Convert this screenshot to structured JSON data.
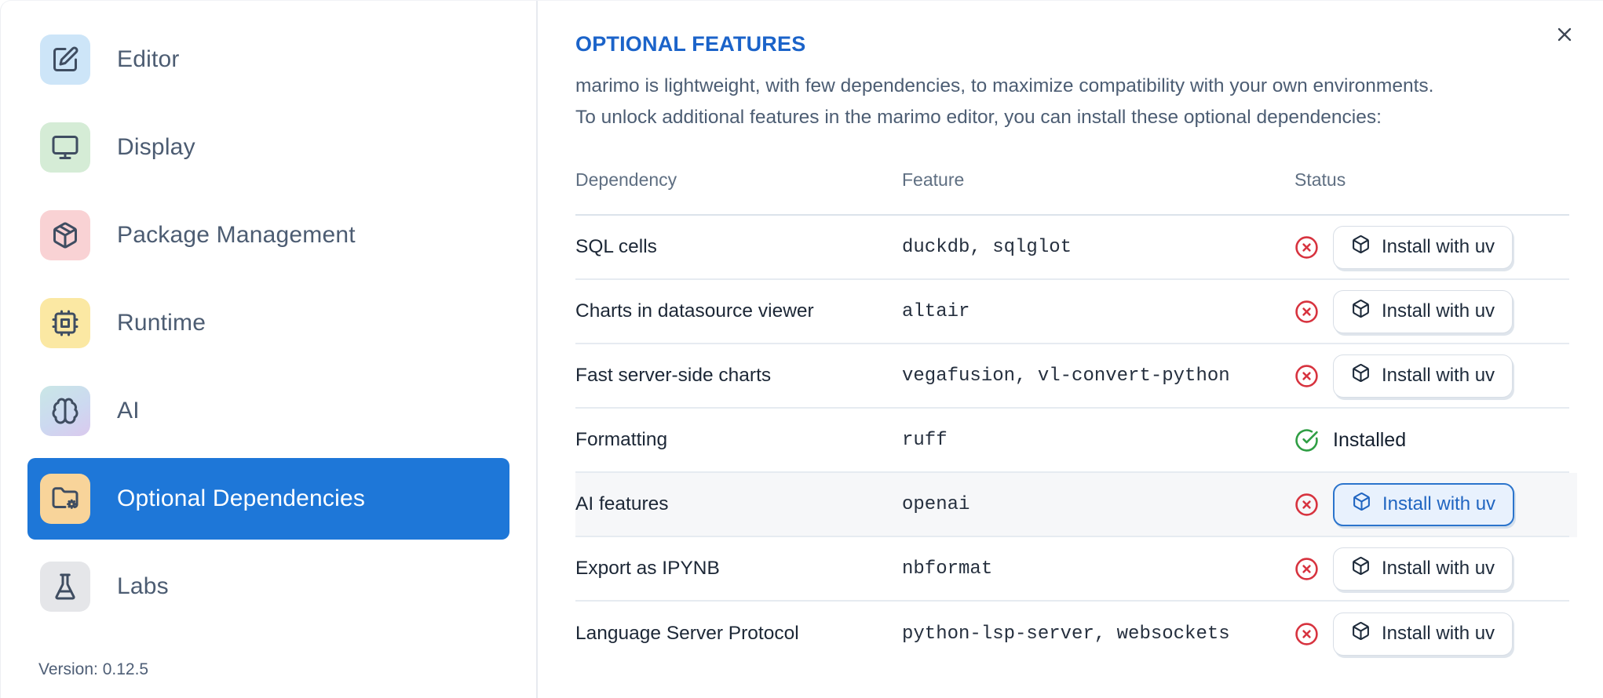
{
  "sidebar": {
    "items": [
      {
        "label": "Editor",
        "icon": "edit-icon",
        "tile_bg": "#cde5f8"
      },
      {
        "label": "Display",
        "icon": "monitor-icon",
        "tile_bg": "#d5ecd6"
      },
      {
        "label": "Package Management",
        "icon": "package-icon",
        "tile_bg": "#f9d2d4"
      },
      {
        "label": "Runtime",
        "icon": "cpu-icon",
        "tile_bg": "#fbe8a3"
      },
      {
        "label": "AI",
        "icon": "brain-icon",
        "tile_bg": "linear-gradient(150deg,#c9e7e6 0%,#ccd9f0 55%,#dac9ee 100%)"
      },
      {
        "label": "Optional Dependencies",
        "icon": "folder-cog-icon",
        "tile_bg": "#f8d49a",
        "selected": true
      },
      {
        "label": "Labs",
        "icon": "flask-icon",
        "tile_bg": "#e5e6e9"
      }
    ],
    "version_label": "Version: 0.12.5"
  },
  "panel": {
    "title": "OPTIONAL FEATURES",
    "description_lines": [
      "marimo is lightweight, with few dependencies, to maximize compatibility with your own environments.",
      "To unlock additional features in the marimo editor, you can install these optional dependencies:"
    ]
  },
  "table": {
    "headers": [
      "Dependency",
      "Feature",
      "Status"
    ],
    "install_button_label": "Install with uv",
    "installed_label": "Installed",
    "rows": [
      {
        "dependency": "SQL cells",
        "feature": "duckdb, sqlglot",
        "installed": false,
        "highlight": false
      },
      {
        "dependency": "Charts in datasource viewer",
        "feature": "altair",
        "installed": false,
        "highlight": false
      },
      {
        "dependency": "Fast server-side charts",
        "feature": "vegafusion, vl-convert-python",
        "installed": false,
        "highlight": false
      },
      {
        "dependency": "Formatting",
        "feature": "ruff",
        "installed": true,
        "highlight": false
      },
      {
        "dependency": "AI features",
        "feature": "openai",
        "installed": false,
        "highlight": true
      },
      {
        "dependency": "Export as IPYNB",
        "feature": "nbformat",
        "installed": false,
        "highlight": false
      },
      {
        "dependency": "Language Server Protocol",
        "feature": "python-lsp-server, websockets",
        "installed": false,
        "highlight": false
      }
    ]
  },
  "colors": {
    "accent_blue": "#1e77d8",
    "title_blue": "#1b63c9",
    "button_highlight_blue": "#2065c1",
    "status_red": "#d7333f",
    "status_green": "#2f9e44"
  }
}
